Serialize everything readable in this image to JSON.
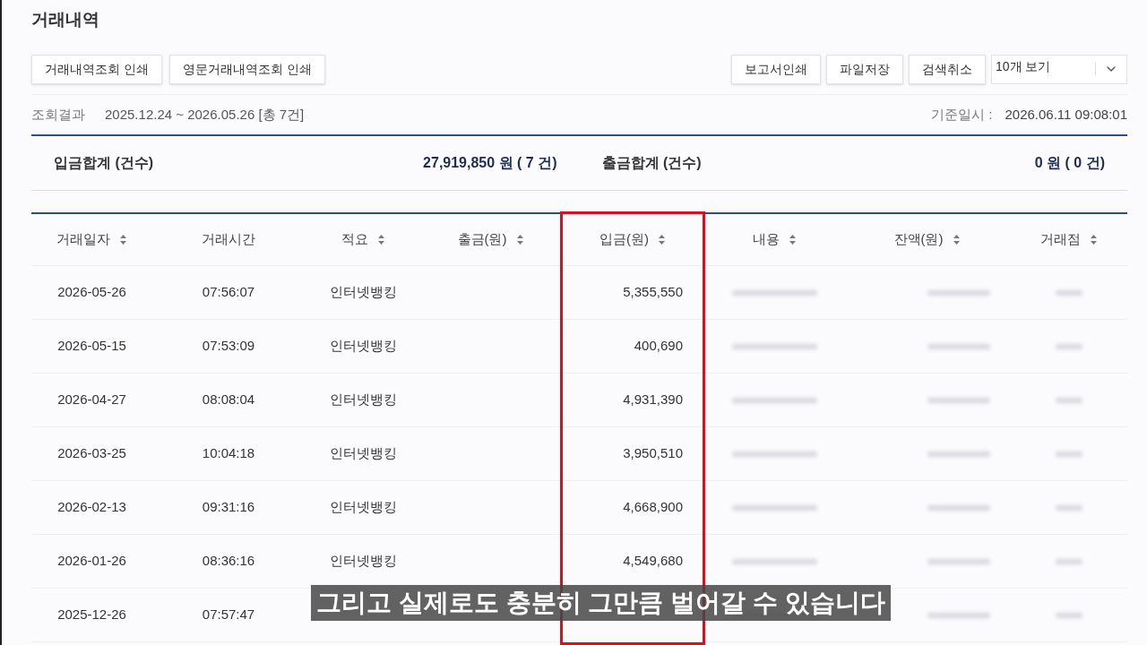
{
  "title": "거래내역",
  "left_buttons": [
    "거래내역조회 인쇄",
    "영문거래내역조회 인쇄"
  ],
  "right_buttons": [
    "보고서인쇄",
    "파일저장",
    "검색취소"
  ],
  "page_size_select": {
    "value": "10개 보기"
  },
  "result": {
    "label": "조회결과",
    "range": "2025.12.24 ~ 2026.05.26 [총 7건]",
    "as_of_label": "기준일시 :",
    "as_of": "2026.06.11 09:08:01"
  },
  "summary": [
    {
      "label": "입금합계 (건수)",
      "value": "27,919,850 원 ( 7 건)"
    },
    {
      "label": "출금합계 (건수)",
      "value": "0 원 ( 0 건)"
    }
  ],
  "table": {
    "columns": [
      {
        "label": "거래일자",
        "sortable": true,
        "kind": "text",
        "highlighted": false
      },
      {
        "label": "거래시간",
        "sortable": false,
        "kind": "text",
        "highlighted": false
      },
      {
        "label": "적요",
        "sortable": true,
        "kind": "text",
        "highlighted": false
      },
      {
        "label": "출금(원)",
        "sortable": true,
        "kind": "text",
        "highlighted": false
      },
      {
        "label": "입금(원)",
        "sortable": true,
        "kind": "text",
        "highlighted": true
      },
      {
        "label": "내용",
        "sortable": true,
        "kind": "blurred",
        "highlighted": false
      },
      {
        "label": "잔액(원)",
        "sortable": true,
        "kind": "blurred",
        "highlighted": false
      },
      {
        "label": "거래점",
        "sortable": true,
        "kind": "blurred",
        "highlighted": false
      }
    ],
    "rows": [
      [
        "2026-05-26",
        "07:56:07",
        "인터넷뱅킹",
        "",
        "5,355,550"
      ],
      [
        "2026-05-15",
        "07:53:09",
        "인터넷뱅킹",
        "",
        "400,690"
      ],
      [
        "2026-04-27",
        "08:08:04",
        "인터넷뱅킹",
        "",
        "4,931,390"
      ],
      [
        "2026-03-25",
        "10:04:18",
        "인터넷뱅킹",
        "",
        "3,950,510"
      ],
      [
        "2026-02-13",
        "09:31:16",
        "인터넷뱅킹",
        "",
        "4,668,900"
      ],
      [
        "2026-01-26",
        "08:36:16",
        "인터넷뱅킹",
        "",
        "4,549,680"
      ],
      [
        "2025-12-26",
        "07:57:47",
        "",
        "",
        ""
      ]
    ]
  },
  "subtitle": "그리고 실제로도 충분히 그만큼 벌어갈 수 있습니다"
}
